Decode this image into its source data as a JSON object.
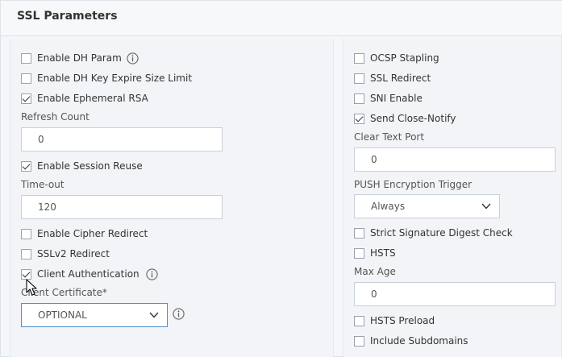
{
  "panel": {
    "title": "SSL Parameters"
  },
  "left": {
    "enable_dh_param": {
      "label": "Enable DH Param",
      "checked": false
    },
    "enable_dh_key_expire": {
      "label": "Enable DH Key Expire Size Limit",
      "checked": false
    },
    "enable_ephemeral_rsa": {
      "label": "Enable Ephemeral RSA",
      "checked": true
    },
    "refresh_count": {
      "label": "Refresh Count",
      "value": "0"
    },
    "enable_session_reuse": {
      "label": "Enable Session Reuse",
      "checked": true
    },
    "timeout": {
      "label": "Time-out",
      "value": "120"
    },
    "enable_cipher_redirect": {
      "label": "Enable Cipher Redirect",
      "checked": false
    },
    "sslv2_redirect": {
      "label": "SSLv2 Redirect",
      "checked": false
    },
    "client_authentication": {
      "label": "Client Authentication",
      "checked": true
    },
    "client_certificate": {
      "label": "Client Certificate*",
      "value": "OPTIONAL"
    }
  },
  "right": {
    "ocsp_stapling": {
      "label": "OCSP Stapling",
      "checked": false
    },
    "ssl_redirect": {
      "label": "SSL Redirect",
      "checked": false
    },
    "sni_enable": {
      "label": "SNI Enable",
      "checked": false
    },
    "send_close_notify": {
      "label": "Send Close-Notify",
      "checked": true
    },
    "clear_text_port": {
      "label": "Clear Text Port",
      "value": "0"
    },
    "push_encryption_trigger": {
      "label": "PUSH Encryption Trigger",
      "value": "Always"
    },
    "strict_signature_digest_check": {
      "label": "Strict Signature Digest Check",
      "checked": false
    },
    "hsts": {
      "label": "HSTS",
      "checked": false
    },
    "max_age": {
      "label": "Max Age",
      "value": "0"
    },
    "hsts_preload": {
      "label": "HSTS Preload",
      "checked": false
    },
    "include_subdomains": {
      "label": "Include Subdomains",
      "checked": false
    }
  },
  "icons": {
    "info": "info-icon",
    "dropdown": "chevron-down-icon",
    "cursor": "mouse-pointer-icon"
  },
  "colors": {
    "focus_border": "#4a90c8",
    "input_border": "#c9d0d8",
    "panel_bg": "#f2f4f7"
  }
}
